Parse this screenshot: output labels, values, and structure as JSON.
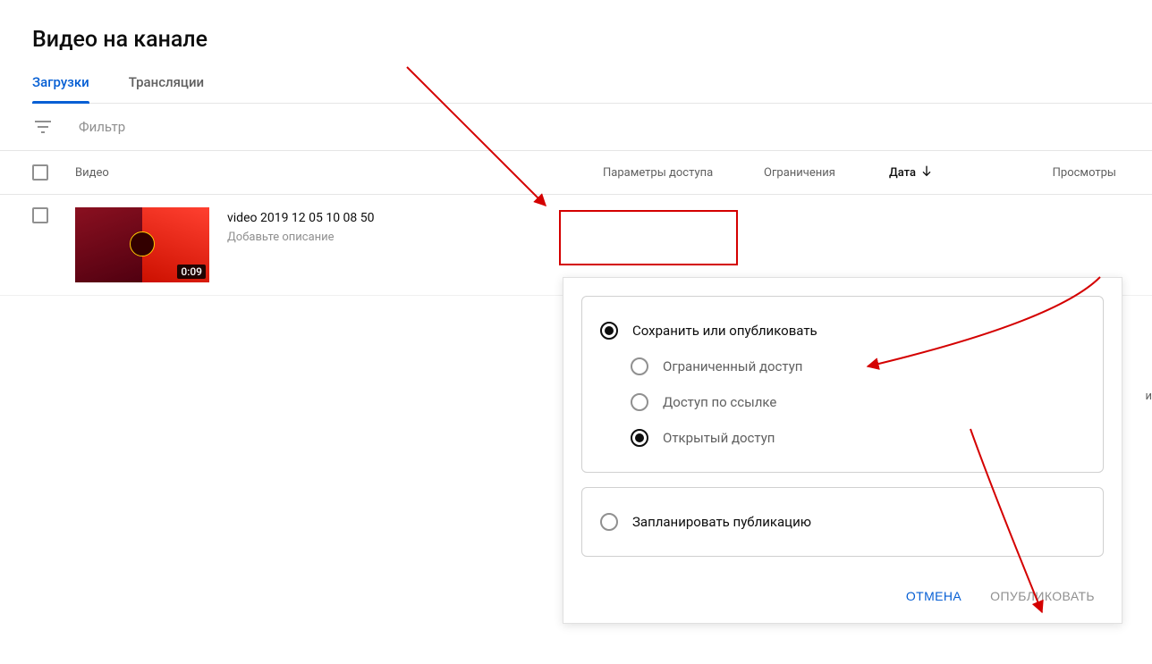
{
  "page_title": "Видео на канале",
  "tabs": [
    {
      "label": "Загрузки",
      "active": true
    },
    {
      "label": "Трансляции",
      "active": false
    }
  ],
  "filter_placeholder": "Фильтр",
  "columns": {
    "video": "Видео",
    "visibility": "Параметры доступа",
    "restrictions": "Ограничения",
    "date": "Дата",
    "views": "Просмотры"
  },
  "video_row": {
    "title": "video 2019 12 05 10 08 50",
    "description_placeholder": "Добавьте описание",
    "duration": "0:09"
  },
  "visibility_popup": {
    "save_publish": "Сохранить или опубликовать",
    "options": [
      {
        "label": "Ограниченный доступ",
        "selected": false
      },
      {
        "label": "Доступ по ссылке",
        "selected": false
      },
      {
        "label": "Открытый доступ",
        "selected": true
      }
    ],
    "schedule": "Запланировать публикацию",
    "cancel": "ОТМЕНА",
    "publish": "ОПУБЛИКОВАТЬ"
  },
  "partial_text_right": "и",
  "colors": {
    "accent": "#065fd4",
    "annotation": "#d40000"
  }
}
